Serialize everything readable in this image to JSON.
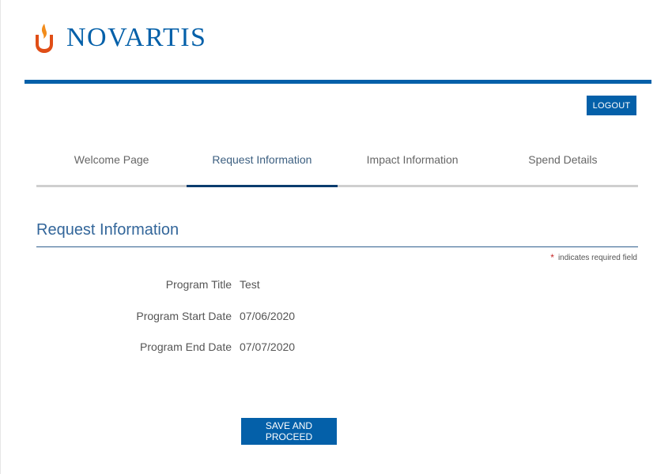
{
  "brand": {
    "name": "NOVARTIS",
    "logo_icon": "novartis-flame-logo",
    "primary_color": "#0460a9"
  },
  "header": {
    "logout_label": "LOGOUT"
  },
  "tabs": [
    {
      "label": "Welcome Page",
      "active": false
    },
    {
      "label": "Request Information",
      "active": true
    },
    {
      "label": "Impact Information",
      "active": false
    },
    {
      "label": "Spend Details",
      "active": false
    }
  ],
  "section": {
    "title": "Request Information",
    "required_star": "*",
    "required_note": "indicates required field"
  },
  "fields": [
    {
      "label": "Program Title",
      "value": "Test"
    },
    {
      "label": "Program Start Date",
      "value": "07/06/2020"
    },
    {
      "label": "Program End Date",
      "value": "07/07/2020"
    }
  ],
  "actions": {
    "save_label": "SAVE AND PROCEED"
  }
}
